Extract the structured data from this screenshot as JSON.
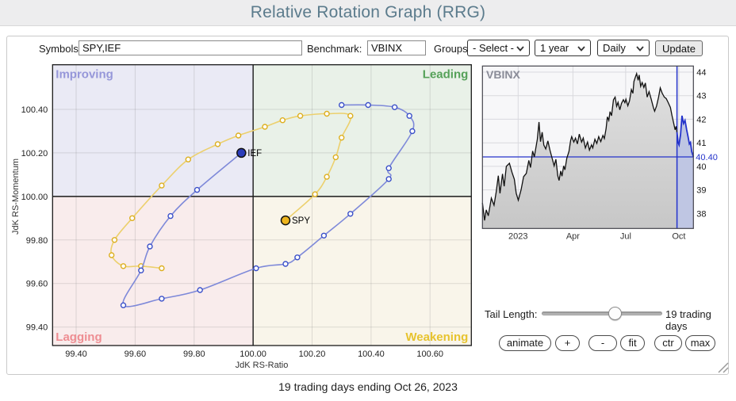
{
  "header": {
    "title": "Relative Rotation Graph (RRG)"
  },
  "toolbar": {
    "symbols_label": "Symbols:",
    "symbols_value": "SPY,IEF",
    "benchmark_label": "Benchmark:",
    "benchmark_value": "VBINX",
    "groups_label": "Groups:",
    "groups_value": "- Select -",
    "period_value": "1 year",
    "frequency_value": "Daily",
    "update_label": "Update"
  },
  "rrg": {
    "x_axis": {
      "title": "JdK RS-Ratio",
      "tick_values": [
        99.4,
        99.6,
        99.8,
        100.0,
        100.2,
        100.4,
        100.6
      ],
      "tick_labels": [
        "99.40",
        "99.60",
        "99.80",
        "100.00",
        "100.20",
        "100.40",
        "100.60"
      ]
    },
    "y_axis": {
      "title": "JdK RS-Momentum",
      "tick_values": [
        100.4,
        100.2,
        100.0,
        99.8,
        99.6,
        99.4
      ],
      "tick_labels": [
        "100.40",
        "100.20",
        "100.00",
        "99.80",
        "99.60",
        "99.40"
      ]
    },
    "x_range": [
      99.32,
      100.74
    ],
    "y_range": [
      99.315,
      100.605
    ],
    "center": [
      100.0,
      100.0
    ],
    "quadrants": {
      "improving": {
        "label": "Improving",
        "bg": "#eaeaf5",
        "color": "#9697d9"
      },
      "leading": {
        "label": "Leading",
        "bg": "#e9f1e8",
        "color": "#55a158"
      },
      "lagging": {
        "label": "Lagging",
        "bg": "#f9ecec",
        "color": "#ee8d92"
      },
      "weakening": {
        "label": "Weakening",
        "bg": "#f9f5ea",
        "color": "#e7c32e"
      }
    },
    "series": [
      {
        "name": "SPY",
        "line_color": "#ecd06d",
        "marker_color": "#ddaf1f",
        "end_fill": "#edb41d",
        "points": [
          [
            99.69,
            99.67
          ],
          [
            99.62,
            99.68
          ],
          [
            99.56,
            99.68
          ],
          [
            99.52,
            99.73
          ],
          [
            99.53,
            99.8
          ],
          [
            99.59,
            99.9
          ],
          [
            99.69,
            100.05
          ],
          [
            99.78,
            100.17
          ],
          [
            99.88,
            100.24
          ],
          [
            99.95,
            100.28
          ],
          [
            100.04,
            100.32
          ],
          [
            100.1,
            100.35
          ],
          [
            100.16,
            100.37
          ],
          [
            100.25,
            100.38
          ],
          [
            100.33,
            100.37
          ],
          [
            100.3,
            100.27
          ],
          [
            100.28,
            100.18
          ],
          [
            100.25,
            100.09
          ],
          [
            100.21,
            100.01
          ],
          [
            100.11,
            99.89
          ]
        ]
      },
      {
        "name": "IEF",
        "line_color": "#7e89d9",
        "marker_color": "#3b50c9",
        "end_fill": "#2b3cbb",
        "points": [
          [
            100.3,
            100.42
          ],
          [
            100.39,
            100.42
          ],
          [
            100.48,
            100.41
          ],
          [
            100.53,
            100.37
          ],
          [
            100.54,
            100.3
          ],
          [
            100.46,
            100.13
          ],
          [
            100.46,
            100.08
          ],
          [
            100.33,
            99.92
          ],
          [
            100.24,
            99.82
          ],
          [
            100.15,
            99.72
          ],
          [
            100.11,
            99.69
          ],
          [
            100.01,
            99.67
          ],
          [
            99.82,
            99.57
          ],
          [
            99.69,
            99.53
          ],
          [
            99.56,
            99.5
          ],
          [
            99.62,
            99.66
          ],
          [
            99.65,
            99.77
          ],
          [
            99.72,
            99.91
          ],
          [
            99.81,
            100.03
          ],
          [
            99.96,
            100.2
          ]
        ]
      }
    ]
  },
  "vbinx": {
    "title": "VBINX",
    "y_ticks": [
      44,
      43,
      42,
      41,
      40,
      39,
      38
    ],
    "y_domain": [
      37.36,
      44.26
    ],
    "x_tick_labels": [
      "2023",
      "Apr",
      "Jul",
      "Oct"
    ],
    "x_tick_fracs": [
      0.169,
      0.429,
      0.679,
      0.931
    ],
    "last_value": 40.4,
    "last_value_label": "40.40",
    "tail_start_frac": 0.922,
    "series_main": [
      [
        0.0,
        38.45
      ],
      [
        0.01,
        37.7
      ],
      [
        0.018,
        38.15
      ],
      [
        0.028,
        37.9
      ],
      [
        0.042,
        38.65
      ],
      [
        0.055,
        38.35
      ],
      [
        0.065,
        38.9
      ],
      [
        0.075,
        39.6
      ],
      [
        0.083,
        38.85
      ],
      [
        0.095,
        39.68
      ],
      [
        0.103,
        39.15
      ],
      [
        0.113,
        40.0
      ],
      [
        0.128,
        40.13
      ],
      [
        0.14,
        39.75
      ],
      [
        0.151,
        39.45
      ],
      [
        0.16,
        38.85
      ],
      [
        0.17,
        38.56
      ],
      [
        0.183,
        39.0
      ],
      [
        0.195,
        39.56
      ],
      [
        0.208,
        39.7
      ],
      [
        0.22,
        40.25
      ],
      [
        0.228,
        39.95
      ],
      [
        0.238,
        40.65
      ],
      [
        0.246,
        40.4
      ],
      [
        0.26,
        41.15
      ],
      [
        0.268,
        41.88
      ],
      [
        0.275,
        41.05
      ],
      [
        0.283,
        41.45
      ],
      [
        0.291,
        40.9
      ],
      [
        0.3,
        40.74
      ],
      [
        0.31,
        41.08
      ],
      [
        0.32,
        40.69
      ],
      [
        0.33,
        40.35
      ],
      [
        0.34,
        40.02
      ],
      [
        0.348,
        40.3
      ],
      [
        0.357,
        39.6
      ],
      [
        0.363,
        39.4
      ],
      [
        0.371,
        39.8
      ],
      [
        0.377,
        39.58
      ],
      [
        0.385,
        40.02
      ],
      [
        0.391,
        39.85
      ],
      [
        0.4,
        40.35
      ],
      [
        0.41,
        40.63
      ],
      [
        0.418,
        41.1
      ],
      [
        0.423,
        41.26
      ],
      [
        0.433,
        41.03
      ],
      [
        0.441,
        41.2
      ],
      [
        0.45,
        40.95
      ],
      [
        0.459,
        41.37
      ],
      [
        0.47,
        41.03
      ],
      [
        0.478,
        41.2
      ],
      [
        0.488,
        40.78
      ],
      [
        0.498,
        41.03
      ],
      [
        0.507,
        40.69
      ],
      [
        0.517,
        40.91
      ],
      [
        0.523,
        40.78
      ],
      [
        0.533,
        41.15
      ],
      [
        0.542,
        40.97
      ],
      [
        0.551,
        41.26
      ],
      [
        0.561,
        41.05
      ],
      [
        0.571,
        41.31
      ],
      [
        0.578,
        41.18
      ],
      [
        0.586,
        41.6
      ],
      [
        0.592,
        42.1
      ],
      [
        0.599,
        41.95
      ],
      [
        0.605,
        42.32
      ],
      [
        0.612,
        42.15
      ],
      [
        0.621,
        42.83
      ],
      [
        0.629,
        42.94
      ],
      [
        0.636,
        42.55
      ],
      [
        0.643,
        42.72
      ],
      [
        0.651,
        42.4
      ],
      [
        0.659,
        42.67
      ],
      [
        0.668,
        42.83
      ],
      [
        0.675,
        42.7
      ],
      [
        0.68,
        42.85
      ],
      [
        0.689,
        42.57
      ],
      [
        0.697,
        42.78
      ],
      [
        0.706,
        43.26
      ],
      [
        0.713,
        43.1
      ],
      [
        0.718,
        43.6
      ],
      [
        0.724,
        43.77
      ],
      [
        0.731,
        43.94
      ],
      [
        0.738,
        43.65
      ],
      [
        0.743,
        43.88
      ],
      [
        0.75,
        43.4
      ],
      [
        0.757,
        43.56
      ],
      [
        0.765,
        43.35
      ],
      [
        0.772,
        43.54
      ],
      [
        0.781,
        42.94
      ],
      [
        0.79,
        43.17
      ],
      [
        0.8,
        42.85
      ],
      [
        0.81,
        42.5
      ],
      [
        0.816,
        42.34
      ],
      [
        0.825,
        42.56
      ],
      [
        0.835,
        42.94
      ],
      [
        0.843,
        43.33
      ],
      [
        0.852,
        43.11
      ],
      [
        0.862,
        42.94
      ],
      [
        0.871,
        42.88
      ],
      [
        0.881,
        42.7
      ],
      [
        0.891,
        42.5
      ],
      [
        0.898,
        42.17
      ],
      [
        0.906,
        41.85
      ],
      [
        0.913,
        41.55
      ],
      [
        0.918,
        41.7
      ],
      [
        0.922,
        41.45
      ]
    ],
    "series_recent": [
      [
        0.922,
        41.45
      ],
      [
        0.927,
        41.02
      ],
      [
        0.932,
        40.91
      ],
      [
        0.939,
        41.35
      ],
      [
        0.946,
        42.15
      ],
      [
        0.953,
        41.82
      ],
      [
        0.96,
        41.95
      ],
      [
        0.968,
        41.55
      ],
      [
        0.975,
        41.25
      ],
      [
        0.981,
        40.95
      ],
      [
        0.986,
        41.02
      ],
      [
        0.992,
        40.62
      ],
      [
        1.0,
        40.4
      ]
    ],
    "colors": {
      "line": "#111111",
      "area_top": "#e0e0e0",
      "area_bottom": "#c7c7c7",
      "recent_line": "#2433cb",
      "recent_area": "#bfc6e3",
      "accent": "#2433cb",
      "frame": "#44444c",
      "grid": "#d9d9de",
      "plot_bg": "#f7f7f9",
      "title": "#8a8c98"
    }
  },
  "controls": {
    "tail_length_label": "Tail Length:",
    "tail_length_value": "19 trading days",
    "buttons": [
      "animate",
      "+",
      "-",
      "fit",
      "ctr",
      "max"
    ]
  },
  "footer": {
    "caption": "19 trading days ending Oct 26, 2023"
  }
}
